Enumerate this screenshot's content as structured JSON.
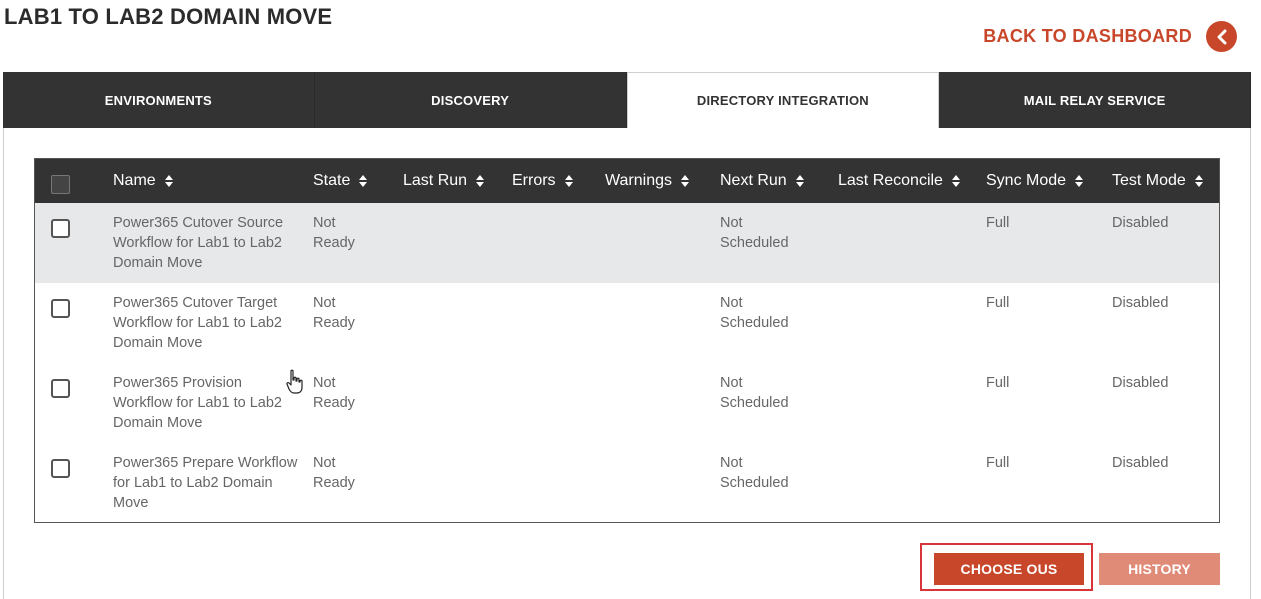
{
  "page": {
    "title": "LAB1 TO LAB2 DOMAIN MOVE"
  },
  "back": {
    "label": "BACK TO DASHBOARD",
    "icon": "chevron-left-icon"
  },
  "tabs": [
    {
      "label": "ENVIRONMENTS",
      "active": false
    },
    {
      "label": "DISCOVERY",
      "active": false
    },
    {
      "label": "DIRECTORY INTEGRATION",
      "active": true
    },
    {
      "label": "MAIL RELAY SERVICE",
      "active": false
    }
  ],
  "table": {
    "columns": [
      "Name",
      "State",
      "Last Run",
      "Errors",
      "Warnings",
      "Next Run",
      "Last Reconcile",
      "Sync Mode",
      "Test Mode"
    ],
    "rows": [
      {
        "name": "Power365 Cutover Source Workflow for Lab1 to Lab2 Domain Move",
        "state": "Not Ready",
        "last_run": "",
        "errors": "",
        "warnings": "",
        "next_run": "Not Scheduled",
        "last_reconcile": "",
        "sync_mode": "Full",
        "test_mode": "Disabled"
      },
      {
        "name": "Power365 Cutover Target Workflow for Lab1 to Lab2 Domain Move",
        "state": "Not Ready",
        "last_run": "",
        "errors": "",
        "warnings": "",
        "next_run": "Not Scheduled",
        "last_reconcile": "",
        "sync_mode": "Full",
        "test_mode": "Disabled"
      },
      {
        "name": "Power365 Provision Workflow for Lab1 to Lab2 Domain Move",
        "state": "Not Ready",
        "last_run": "",
        "errors": "",
        "warnings": "",
        "next_run": "Not Scheduled",
        "last_reconcile": "",
        "sync_mode": "Full",
        "test_mode": "Disabled"
      },
      {
        "name": "Power365 Prepare Workflow for Lab1 to Lab2 Domain Move",
        "state": "Not Ready",
        "last_run": "",
        "errors": "",
        "warnings": "",
        "next_run": "Not Scheduled",
        "last_reconcile": "",
        "sync_mode": "Full",
        "test_mode": "Disabled"
      }
    ]
  },
  "actions": {
    "choose_label": "CHOOSE OUS",
    "history_label": "HISTORY"
  },
  "colors": {
    "accent": "#c8472a",
    "accent_light": "#e08b78",
    "dark": "#333333",
    "row_shade": "#e6e8ea",
    "highlight": "#d9343a"
  }
}
